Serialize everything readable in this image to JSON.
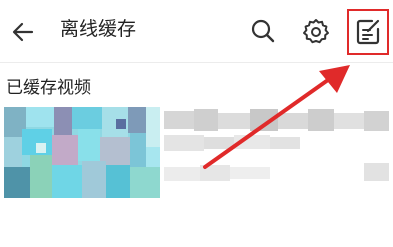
{
  "header": {
    "back_icon": "back-arrow-icon",
    "title": "离线缓存",
    "search_icon": "search-icon",
    "settings_icon": "gear-icon",
    "edit_icon": "edit-note-icon"
  },
  "section": {
    "title": "已缓存视频"
  },
  "colors": {
    "highlight": "#e02a2a",
    "arrow": "#e02a2a",
    "icon": "#333333"
  }
}
